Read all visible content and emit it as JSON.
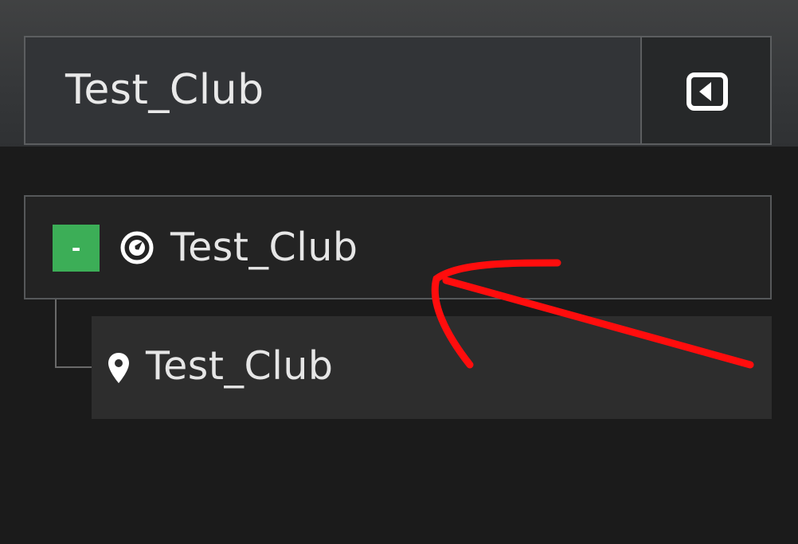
{
  "header": {
    "title": "Test_Club",
    "collapse_icon": "collapse-panel-icon"
  },
  "tree": {
    "root": {
      "toggle_label": "-",
      "icon": "compass-icon",
      "label": "Test_Club",
      "toggle_color": "#3cae57"
    },
    "children": [
      {
        "icon": "location-pin-icon",
        "label": "Test_Club"
      }
    ]
  },
  "annotation": {
    "type": "red-arrow-icon",
    "color": "#ff0d0d"
  }
}
